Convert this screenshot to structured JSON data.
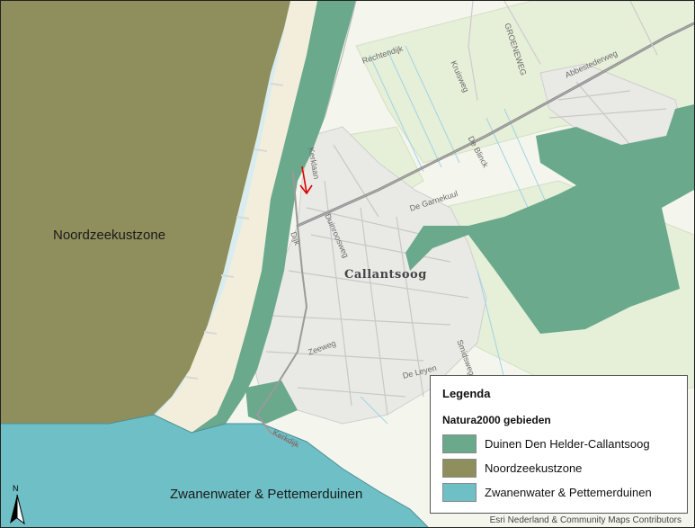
{
  "map": {
    "labels": {
      "noordzee": "Noordzeekustzone",
      "zwanenwater": "Zwanenwater & Pettemerduinen",
      "town": "Callantsoog"
    },
    "streets": {
      "rechtendijk": "Rechtendijk",
      "kruisweg": "Kruisweg",
      "groeneweg": "GROENEWEG",
      "abbestederweg": "Abbestederweg",
      "de_blinck": "De Blinck",
      "de_garnekuul": "De Garnekuul",
      "duinroosweg": "Duinroosweg",
      "zeeweg": "Zeeweg",
      "de_leyen": "De Leyen",
      "smidsweg": "Smidsweg",
      "kerklaan": "Kerklaan",
      "dijk": "Dijk",
      "kerkdijk": "Kerkdijk"
    },
    "colors": {
      "sea": "#8f8f5d",
      "beach": "#f3eedc",
      "dunes_den_helder": "#6aa98c",
      "zwanenwater": "#6fc0c6",
      "land": "#f4f6ee",
      "roads": "#9a9a9a",
      "arrow": "#e00000"
    }
  },
  "legend": {
    "title": "Legenda",
    "subtitle": "Natura2000 gebieden",
    "items": [
      {
        "label": "Duinen Den Helder-Callantsoog",
        "color": "#6aa98c"
      },
      {
        "label": "Noordzeekustzone",
        "color": "#8f8f5d"
      },
      {
        "label": "Zwanenwater & Pettemerduinen",
        "color": "#6fc0c6"
      }
    ]
  },
  "north_arrow": {
    "letter": "N",
    "icon": "north-arrow-icon"
  },
  "credits": "Esri Nederland & Community Maps Contributors"
}
